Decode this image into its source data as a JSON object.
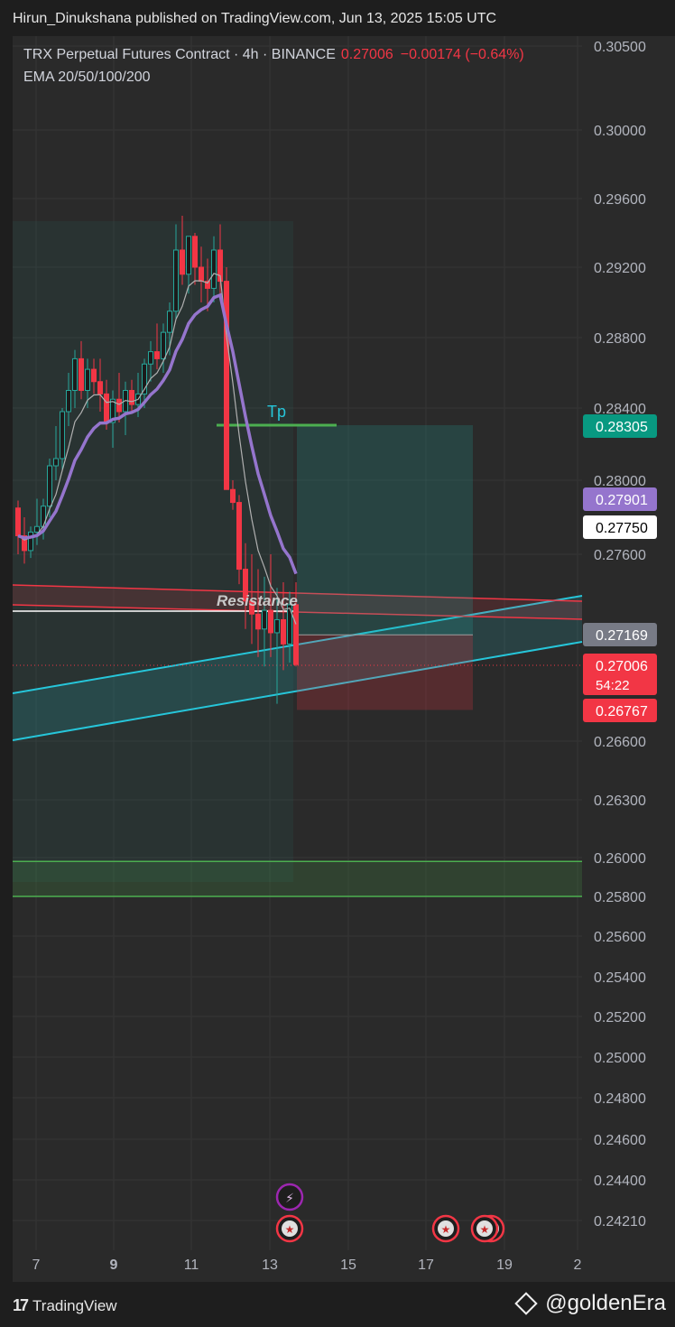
{
  "publisher_line": "Hirun_Dinukshana published on TradingView.com, Jun 13, 2025 15:05 UTC",
  "header": {
    "symbol": "TRX Perpetual Futures Contract · 4h · BINANCE",
    "price": "0.27006",
    "change": "−0.00174 (−0.64%)",
    "indicator": "EMA 20/50/100/200"
  },
  "footer": {
    "logo_text": "TradingView",
    "author_tag": "@goldenEra"
  },
  "colors": {
    "background": "#2a2a2a",
    "bull": "#26a69a",
    "bear": "#f23645",
    "ema20": "#b0b0b0",
    "ema50": "#9575cd",
    "channel": "#26c6da",
    "resistance": "#f23645",
    "support_zone": "#4caf50",
    "tp": "#4caf50"
  },
  "chart_data": {
    "type": "candlestick",
    "y_axis": {
      "ticks": [
        "0.30500",
        "0.30000",
        "0.29600",
        "0.29200",
        "0.28800",
        "0.28400",
        "0.28000",
        "0.27600",
        "0.26600",
        "0.26300",
        "0.26000",
        "0.25800",
        "0.25600",
        "0.25400",
        "0.25200",
        "0.25000",
        "0.24800",
        "0.24600",
        "0.24400",
        "0.24210"
      ],
      "scale": "non-linear"
    },
    "x_axis": {
      "ticks": [
        "7",
        "9",
        "11",
        "13",
        "15",
        "17",
        "19",
        "2"
      ],
      "bold_tick": "9"
    },
    "price_tags": [
      {
        "label": "0.28305",
        "color": "#089981",
        "role": "take-profit"
      },
      {
        "label": "0.27901",
        "color": "#9575cd",
        "role": "ema50"
      },
      {
        "label": "0.27750",
        "color": "#ffffff",
        "role": "ema20"
      },
      {
        "label": "0.27169",
        "color": "#787b86",
        "role": "entry"
      },
      {
        "label": "0.27006",
        "color": "#f23645",
        "role": "last-price"
      },
      {
        "label": "54:22",
        "color": "#f23645",
        "role": "countdown"
      },
      {
        "label": "0.26767",
        "color": "#f23645",
        "role": "stop-loss"
      }
    ],
    "annotations": [
      {
        "text": "Resistance",
        "type": "label"
      },
      {
        "text": "Tp",
        "type": "label"
      }
    ],
    "candles": [
      [
        0.2785,
        0.2789,
        0.276,
        0.277
      ],
      [
        0.277,
        0.278,
        0.2755,
        0.2762
      ],
      [
        0.2762,
        0.2775,
        0.2758,
        0.2772
      ],
      [
        0.2772,
        0.279,
        0.2765,
        0.2775
      ],
      [
        0.2775,
        0.279,
        0.2768,
        0.2786
      ],
      [
        0.2786,
        0.2812,
        0.278,
        0.2808
      ],
      [
        0.2808,
        0.283,
        0.28,
        0.2812
      ],
      [
        0.2812,
        0.284,
        0.2805,
        0.2838
      ],
      [
        0.2838,
        0.286,
        0.283,
        0.285
      ],
      [
        0.285,
        0.2873,
        0.284,
        0.2868
      ],
      [
        0.2868,
        0.2878,
        0.2845,
        0.285
      ],
      [
        0.285,
        0.2868,
        0.284,
        0.2862
      ],
      [
        0.2862,
        0.2868,
        0.2848,
        0.2855
      ],
      [
        0.2855,
        0.2868,
        0.2838,
        0.2848
      ],
      [
        0.2848,
        0.2856,
        0.2828,
        0.2832
      ],
      [
        0.2832,
        0.285,
        0.2818,
        0.2845
      ],
      [
        0.2845,
        0.286,
        0.2832,
        0.2838
      ],
      [
        0.2838,
        0.2855,
        0.2825,
        0.285
      ],
      [
        0.285,
        0.2856,
        0.2838,
        0.2842
      ],
      [
        0.2842,
        0.286,
        0.2835,
        0.2848
      ],
      [
        0.2848,
        0.2868,
        0.284,
        0.2865
      ],
      [
        0.2865,
        0.2878,
        0.2855,
        0.2872
      ],
      [
        0.2872,
        0.2888,
        0.2862,
        0.2868
      ],
      [
        0.2868,
        0.2888,
        0.286,
        0.2883
      ],
      [
        0.2883,
        0.29,
        0.287,
        0.2895
      ],
      [
        0.2895,
        0.2945,
        0.289,
        0.293
      ],
      [
        0.293,
        0.295,
        0.291,
        0.2916
      ],
      [
        0.2916,
        0.2935,
        0.2905,
        0.2938
      ],
      [
        0.2938,
        0.294,
        0.291,
        0.292
      ],
      [
        0.292,
        0.2932,
        0.29,
        0.2912
      ],
      [
        0.2912,
        0.2925,
        0.2895,
        0.2908
      ],
      [
        0.2908,
        0.2938,
        0.29,
        0.293
      ],
      [
        0.293,
        0.2945,
        0.2905,
        0.2912
      ],
      [
        0.2912,
        0.292,
        0.282,
        0.2795
      ],
      [
        0.2795,
        0.28,
        0.2784,
        0.2788
      ],
      [
        0.2788,
        0.2792,
        0.2744,
        0.2752
      ],
      [
        0.2752,
        0.2766,
        0.272,
        0.2735
      ],
      [
        0.2735,
        0.276,
        0.2712,
        0.2728
      ],
      [
        0.2728,
        0.2752,
        0.2705,
        0.272
      ],
      [
        0.272,
        0.2748,
        0.27,
        0.273
      ],
      [
        0.273,
        0.276,
        0.2705,
        0.2718
      ],
      [
        0.2718,
        0.2742,
        0.268,
        0.2725
      ],
      [
        0.2725,
        0.2745,
        0.2698,
        0.2712
      ],
      [
        0.2712,
        0.274,
        0.2702,
        0.2733
      ],
      [
        0.2733,
        0.2745,
        0.27,
        0.2701
      ]
    ]
  }
}
